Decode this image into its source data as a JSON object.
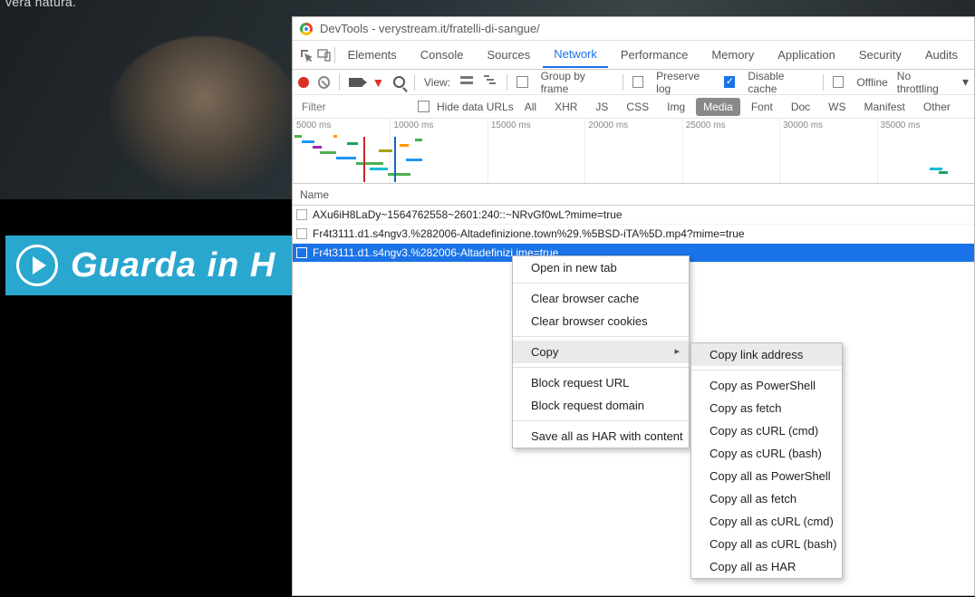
{
  "bg": {
    "partial_text": "vera natura."
  },
  "watch": {
    "label": "Guarda in H"
  },
  "devtools": {
    "title": "DevTools - verystream.it/fratelli-di-sangue/",
    "tabs": [
      "Elements",
      "Console",
      "Sources",
      "Network",
      "Performance",
      "Memory",
      "Application",
      "Security",
      "Audits"
    ],
    "active_tab": "Network",
    "toolbar": {
      "view_label": "View:",
      "group_label": "Group by frame",
      "preserve_label": "Preserve log",
      "disable_label": "Disable cache",
      "offline_label": "Offline",
      "throttle": "No throttling"
    },
    "filter_placeholder": "Filter",
    "hide_data_urls_label": "Hide data URLs",
    "types": [
      "All",
      "XHR",
      "JS",
      "CSS",
      "Img",
      "Media",
      "Font",
      "Doc",
      "WS",
      "Manifest",
      "Other"
    ],
    "active_type": "Media",
    "timeline_ticks": [
      "5000 ms",
      "10000 ms",
      "15000 ms",
      "20000 ms",
      "25000 ms",
      "30000 ms",
      "35000 ms"
    ],
    "name_header": "Name",
    "rows": [
      "AXu6iH8LaDy~1564762558~2601:240::~NRvGf0wL?mime=true",
      "Fr4t3111.d1.s4ngv3.%282006-Altadefinizione.town%29.%5BSD-iTA%5D.mp4?mime=true",
      "Fr4t3111.d1.s4ngv3.%282006-Altadefinizi                                     ime=true"
    ],
    "selected_row": 2
  },
  "ctx1": {
    "open_new_tab": "Open in new tab",
    "clear_cache": "Clear browser cache",
    "clear_cookies": "Clear browser cookies",
    "copy": "Copy",
    "block_url": "Block request URL",
    "block_domain": "Block request domain",
    "save_har": "Save all as HAR with content"
  },
  "ctx2": {
    "link_addr": "Copy link address",
    "powershell": "Copy as PowerShell",
    "fetch": "Copy as fetch",
    "curl_cmd": "Copy as cURL (cmd)",
    "curl_bash": "Copy as cURL (bash)",
    "all_powershell": "Copy all as PowerShell",
    "all_fetch": "Copy all as fetch",
    "all_curl_cmd": "Copy all as cURL (cmd)",
    "all_curl_bash": "Copy all as cURL (bash)",
    "all_har": "Copy all as HAR"
  }
}
